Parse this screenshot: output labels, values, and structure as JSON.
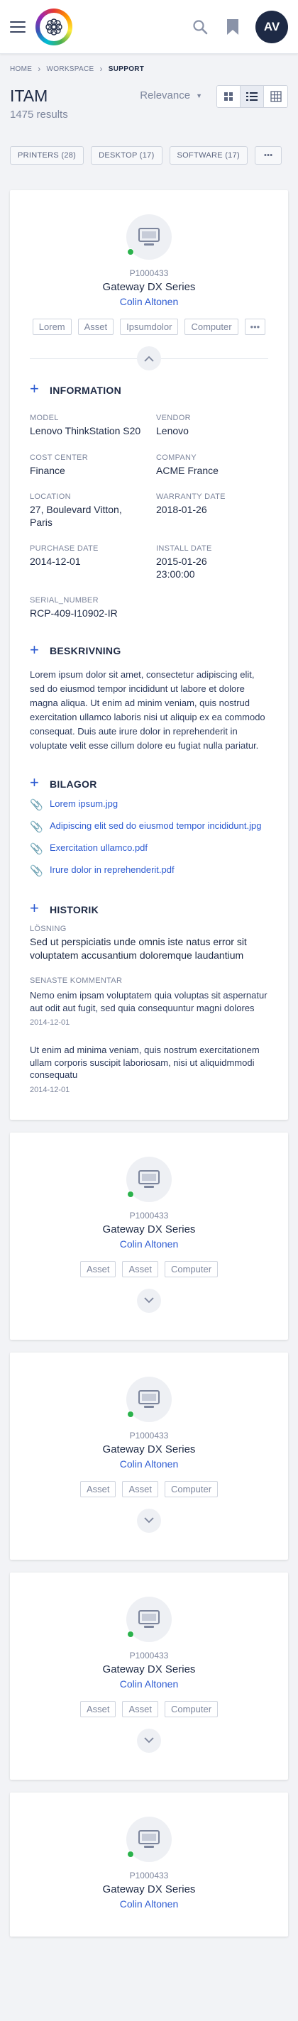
{
  "header": {
    "logo": "app-logo",
    "avatar_initials": "AV"
  },
  "breadcrumb": [
    "HOME",
    "WORKSPACE",
    "SUPPORT"
  ],
  "page": {
    "title": "ITAM",
    "results": "1475 results",
    "sort_label": "Relevance"
  },
  "filters": [
    "PRINTERS (28)",
    "DESKTOP (17)",
    "SOFTWARE (17)"
  ],
  "cards": [
    {
      "id": "P1000433",
      "model": "Gateway DX Series",
      "person": "Colin Altonen",
      "tags": [
        "Lorem",
        "Asset",
        "Ipsumdolor",
        "Computer"
      ],
      "status_color": "#2bb24c"
    },
    {
      "id": "P1000433",
      "model": "Gateway DX Series",
      "person": "Colin Altonen",
      "tags": [
        "Asset",
        "Asset",
        "Computer"
      ]
    },
    {
      "id": "P1000433",
      "model": "Gateway DX Series",
      "person": "Colin Altonen",
      "tags": [
        "Asset",
        "Asset",
        "Computer"
      ]
    },
    {
      "id": "P1000433",
      "model": "Gateway DX Series",
      "person": "Colin Altonen",
      "tags": [
        "Asset",
        "Asset",
        "Computer"
      ]
    },
    {
      "id": "P1000433",
      "model": "Gateway DX Series",
      "person": "Colin Altonen"
    }
  ],
  "information": {
    "heading": "INFORMATION",
    "fields": [
      {
        "label": "MODEL",
        "value": "Lenovo ThinkStation S20"
      },
      {
        "label": "VENDOR",
        "value": "Lenovo"
      },
      {
        "label": "COST CENTER",
        "value": "Finance"
      },
      {
        "label": "COMPANY",
        "value": "ACME France"
      },
      {
        "label": "LOCATION",
        "value": "27, Boulevard Vitton, Paris"
      },
      {
        "label": "WARRANTY DATE",
        "value": "2018-01-26"
      },
      {
        "label": "PURCHASE DATE",
        "value": "2014-12-01"
      },
      {
        "label": "INSTALL DATE",
        "value": "2015-01-26 23:00:00"
      },
      {
        "label": "SERIAL_NUMBER",
        "value": "RCP-409-I10902-IR"
      }
    ]
  },
  "beskrivning": {
    "heading": "BESKRIVNING",
    "text": "Lorem ipsum dolor sit amet, consectetur adipiscing elit, sed do eiusmod tempor incididunt ut labore et dolore magna aliqua. Ut enim ad minim veniam, quis nostrud exercitation ullamco laboris nisi ut aliquip ex ea commodo consequat. Duis aute irure dolor in reprehenderit in voluptate velit esse cillum dolore eu fugiat nulla pariatur."
  },
  "bilagor": {
    "heading": "BILAGOR",
    "files": [
      "Lorem ipsum.jpg",
      "Adipiscing elit sed do eiusmod tempor incididunt.jpg",
      "Exercitation ullamco.pdf",
      "Irure dolor in reprehenderit.pdf"
    ]
  },
  "historik": {
    "heading": "HISTORIK",
    "losning_label": "LÖSNING",
    "losning_text": "Sed ut perspiciatis unde omnis iste natus error sit voluptatem accusantium doloremque laudantium",
    "comment_label": "SENASTE KOMMENTAR",
    "comments": [
      {
        "text": "Nemo enim ipsam voluptatem quia voluptas sit aspernatur aut odit aut fugit, sed quia consequuntur magni dolores",
        "date": "2014-12-01"
      },
      {
        "text": "Ut enim ad minima veniam, quis nostrum exercitationem ullam corporis suscipit laboriosam, nisi ut aliquidmmodi consequatu",
        "date": "2014-12-01"
      }
    ]
  }
}
